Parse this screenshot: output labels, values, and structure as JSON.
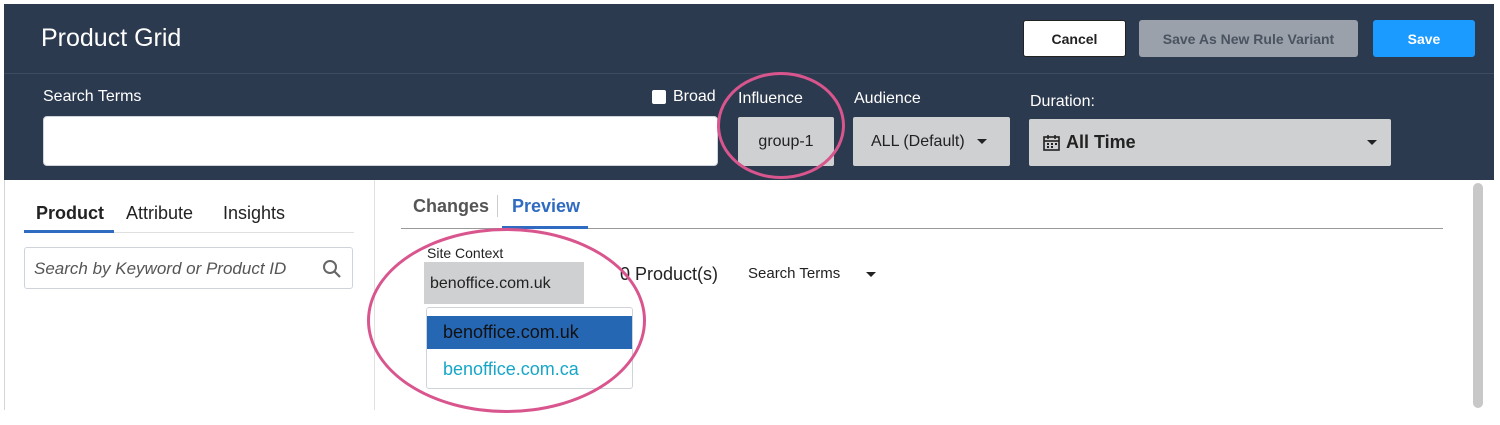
{
  "header": {
    "title": "Product Grid",
    "buttons": {
      "cancel": "Cancel",
      "save_variant": "Save As New Rule Variant",
      "save": "Save"
    }
  },
  "filters": {
    "search_terms_label": "Search Terms",
    "search_terms_value": "",
    "broad_label": "Broad",
    "broad_checked": false,
    "influence_label": "Influence",
    "influence_value": "group-1",
    "audience_label": "Audience",
    "audience_value": "ALL (Default)",
    "duration_label": "Duration:",
    "duration_value": "All Time"
  },
  "left_panel": {
    "tabs": [
      "Product",
      "Attribute",
      "Insights"
    ],
    "active_tab": "Product",
    "search_placeholder": "Search by Keyword or Product ID"
  },
  "main": {
    "tabs": [
      "Changes",
      "Preview"
    ],
    "active_tab": "Preview",
    "site_context_label": "Site Context",
    "site_context_value": "benoffice.com.uk",
    "site_options": [
      "benoffice.com.uk",
      "benoffice.com.ca"
    ],
    "selected_option": "benoffice.com.uk",
    "product_count": "0 Product(s)",
    "sort_label": "Search Terms"
  },
  "colors": {
    "header_bg": "#2c3a4f",
    "save_blue": "#1b9aff",
    "tab_blue": "#2f6bc1",
    "highlight_circle": "#d9558e",
    "option_link": "#17a6c8"
  }
}
